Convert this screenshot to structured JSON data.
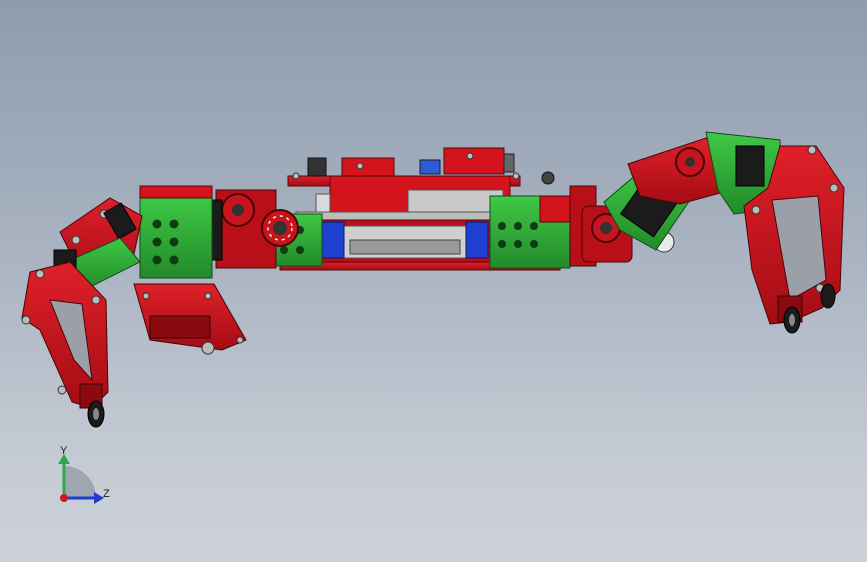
{
  "viewport": {
    "model_name": "",
    "colors": {
      "red": "#d0111b",
      "dark_red": "#8a0a10",
      "green": "#33b53a",
      "dark_green": "#1d7a24",
      "black": "#1b1b1b",
      "blue": "#1f3fd0",
      "gray": "#9aa0a8"
    }
  },
  "triad": {
    "y_label": "Y",
    "z_label": "Z",
    "y_color": "#2ea84a",
    "z_color": "#1e3ecf",
    "origin_color": "#d01818"
  }
}
